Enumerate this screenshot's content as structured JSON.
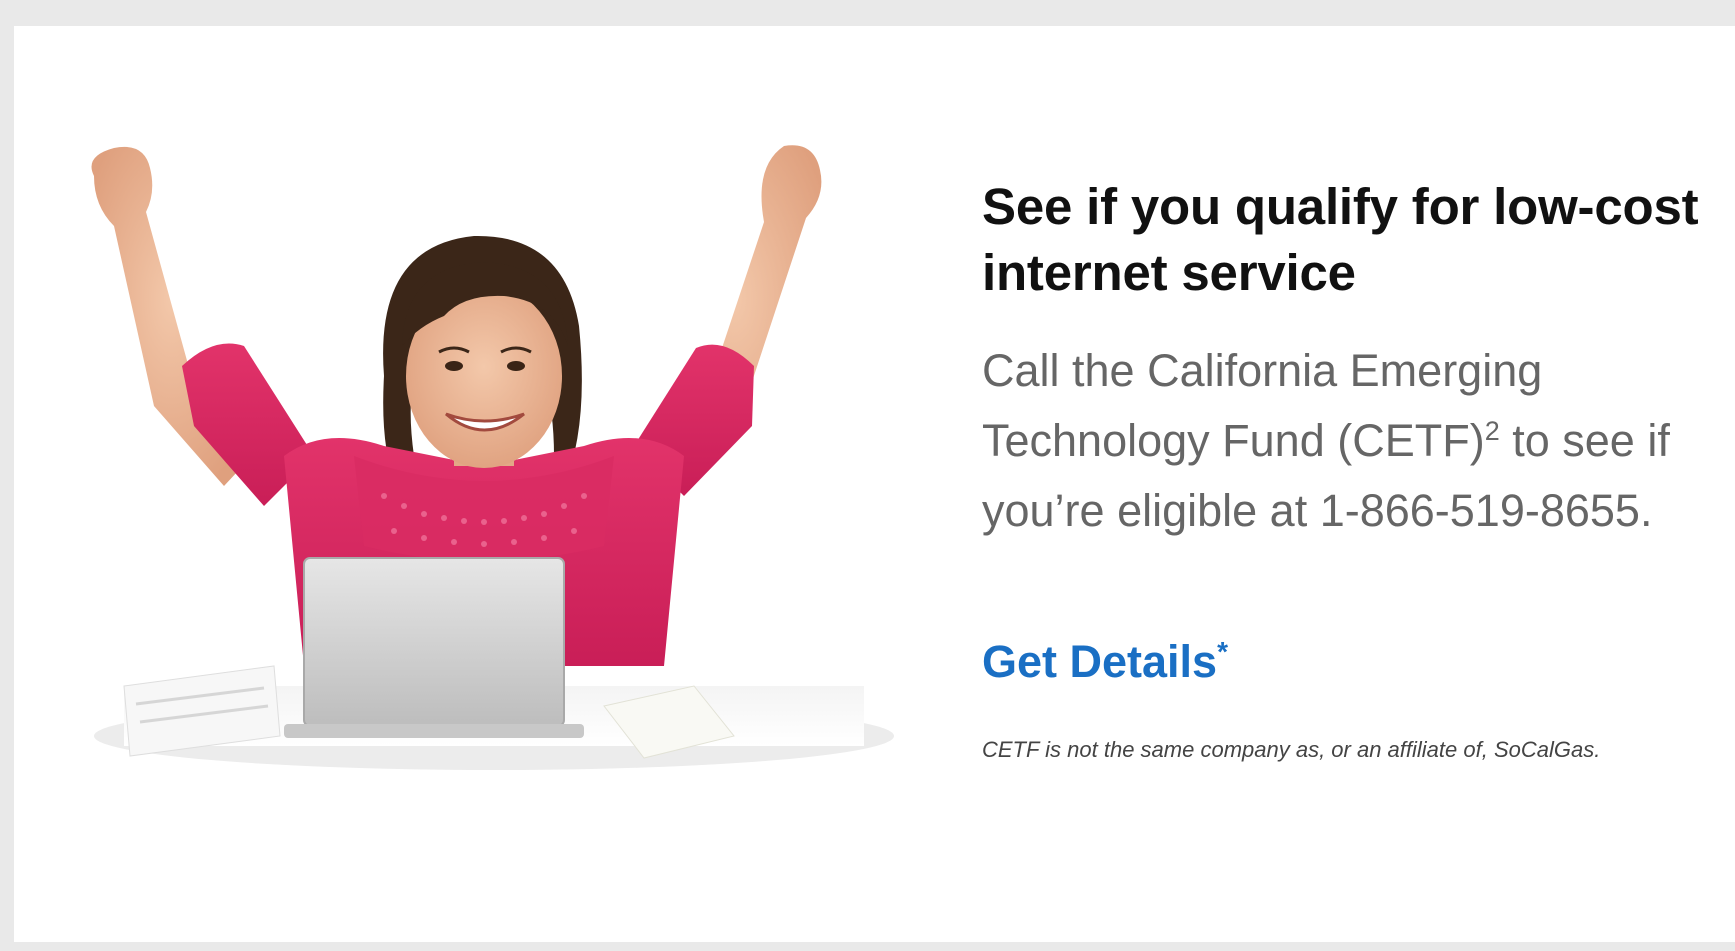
{
  "promo": {
    "headline": "See if you qualify for low-cost internet service",
    "body_prefix": "Call the California Emerging Technology Fund (CETF)",
    "footnote_marker": "2",
    "body_suffix": " to see if you’re eligible at 1-866-519-8655.",
    "cta_label": "Get Details",
    "cta_marker": "*",
    "disclaimer": "CETF is not the same company as, or an affiliate of, SoCalGas."
  },
  "colors": {
    "link": "#1a6fc4",
    "headline": "#111111",
    "body": "#666666",
    "frame": "#e9e9e9"
  }
}
